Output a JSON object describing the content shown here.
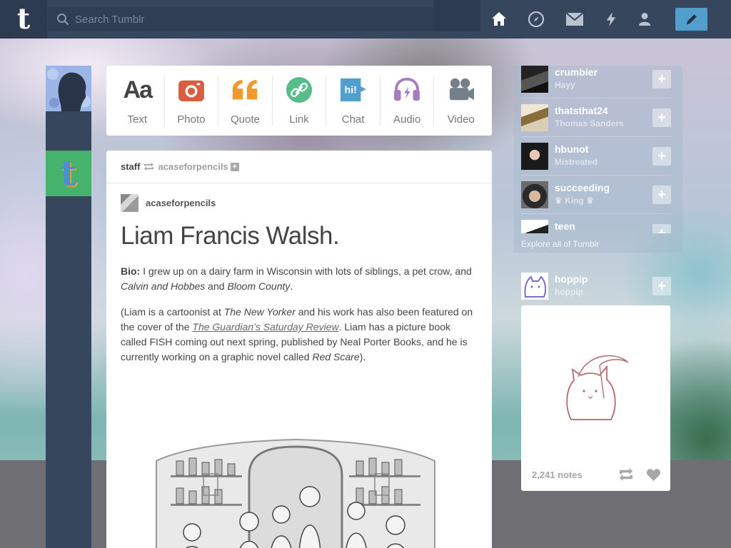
{
  "topbar": {
    "logo": "t",
    "search_placeholder": "Search Tumblr",
    "nav_icons": [
      "home-icon",
      "explore-icon",
      "inbox-icon",
      "activity-icon",
      "account-icon"
    ],
    "compose_icon": "pencil-icon"
  },
  "post_types": [
    {
      "label": "Text",
      "icon": "text-icon",
      "color": "#444444"
    },
    {
      "label": "Photo",
      "icon": "camera-icon",
      "color": "#d95e40"
    },
    {
      "label": "Quote",
      "icon": "quote-icon",
      "color": "#f2992e"
    },
    {
      "label": "Link",
      "icon": "link-icon",
      "color": "#56bc8a"
    },
    {
      "label": "Chat",
      "icon": "chat-icon",
      "color": "#529ecc"
    },
    {
      "label": "Audio",
      "icon": "headphones-icon",
      "color": "#a77dc2"
    },
    {
      "label": "Video",
      "icon": "video-camera-icon",
      "color": "#748089"
    }
  ],
  "post": {
    "reblogger": "staff",
    "source": "acaseforpencils",
    "op_name": "acaseforpencils",
    "title": "Liam Francis Walsh.",
    "bio_label": "Bio:",
    "bio_text_1": " I grew up on a dairy farm in Wisconsin with lots of siblings, a pet crow, and ",
    "bio_em_1": "Calvin and Hobbes",
    "bio_text_2": " and ",
    "bio_em_2": "Bloom County",
    "bio_text_3": ".",
    "p2_text_1": "(Liam is a cartoonist at ",
    "p2_em_1": "The New Yorker",
    "p2_text_2": " and his work has also been featured on the cover of the ",
    "p2_link": "The Guardian’s Saturday Review",
    "p2_text_3": ". Liam has a picture book called FISH coming out next spring, published by Neal Porter Books, and he is currently working on a graphic novel called ",
    "p2_em_2": "Red Scare",
    "p2_text_4": ")."
  },
  "recommended": [
    {
      "name": "crumbier",
      "sub": "Hayy"
    },
    {
      "name": "thatsthat24",
      "sub": "Thomas Sanders"
    },
    {
      "name": "hbunot",
      "sub": "Mistreated"
    },
    {
      "name": "succeeding",
      "sub": "♛ King ♛"
    },
    {
      "name": "teen",
      "sub": ""
    }
  ],
  "explore_link": "Explore all of Tumblr",
  "radar": {
    "blog": "hoppip",
    "sub": "hoppip",
    "notes": "2,241 notes"
  }
}
